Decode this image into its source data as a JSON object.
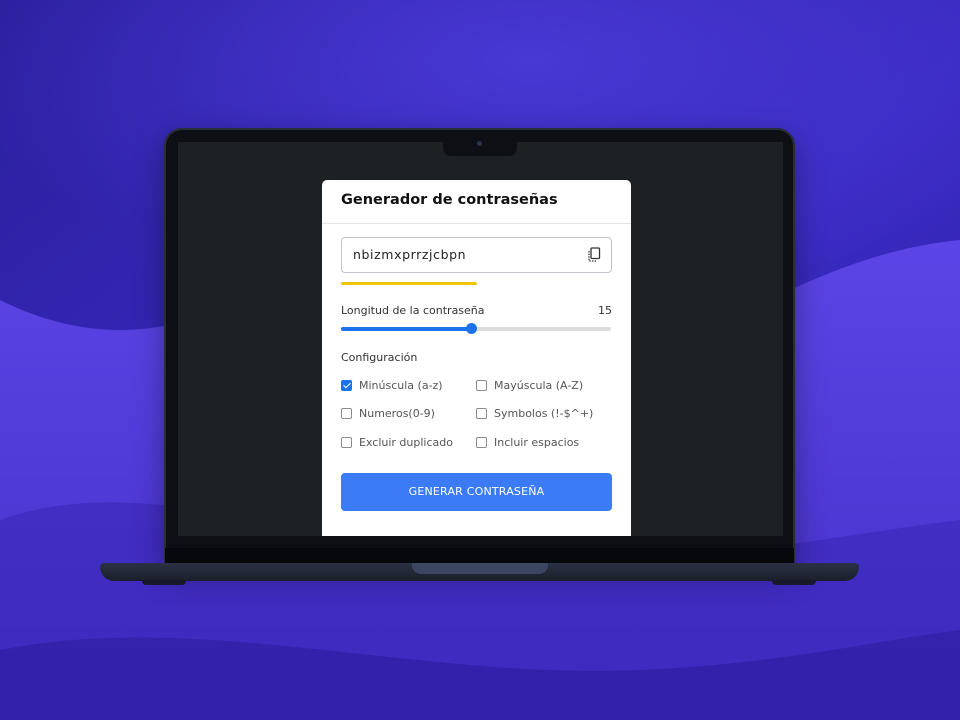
{
  "colors": {
    "background": "#2f22a8",
    "wave": "#5a3fe0",
    "accent": "#3b7cf6",
    "strength": "#f1c40f",
    "screen": "#1e2124"
  },
  "app": {
    "title": "Generador de contraseñas",
    "password": "nbizmxprrzjcbpn",
    "copy_icon": "copy-icon",
    "strength_fraction": 0.5,
    "length_label": "Longitud de la contraseña",
    "length_value": "15",
    "slider_fraction": 0.48,
    "config_label": "Configuración",
    "options": [
      {
        "label": "Minúscula (a-z)",
        "checked": true
      },
      {
        "label": "Mayúscula (A-Z)",
        "checked": false
      },
      {
        "label": "Numeros(0-9)",
        "checked": false
      },
      {
        "label": "Symbolos (!-$^+)",
        "checked": false
      },
      {
        "label": "Excluir duplicado",
        "checked": false
      },
      {
        "label": "Incluir espacios",
        "checked": false
      }
    ],
    "generate_label": "GENERAR CONTRASEÑA"
  }
}
